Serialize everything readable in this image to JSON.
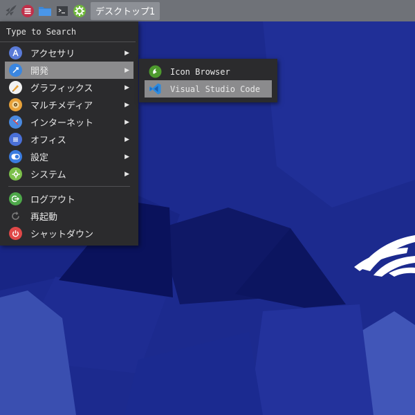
{
  "panel": {
    "workspace_label": "デスクトップ1",
    "icons": [
      "rocket-launcher-icon",
      "menu-icon",
      "folder-icon",
      "terminal-icon",
      "settings-icon"
    ]
  },
  "menu": {
    "search_placeholder": "Type to Search",
    "items": [
      {
        "label": "アクセサリ",
        "icon": "accessories-icon",
        "color": "#5a7bd8",
        "submenu": true
      },
      {
        "label": "開発",
        "icon": "development-icon",
        "color": "#3a86e0",
        "submenu": true,
        "active": true
      },
      {
        "label": "グラフィックス",
        "icon": "graphics-icon",
        "color": "#f2f2f2",
        "submenu": true
      },
      {
        "label": "マルチメディア",
        "icon": "multimedia-icon",
        "color": "#e8a23a",
        "submenu": true
      },
      {
        "label": "インターネット",
        "icon": "internet-icon",
        "color": "#4a8ae0",
        "submenu": true
      },
      {
        "label": "オフィス",
        "icon": "office-icon",
        "color": "#4a70d8",
        "submenu": true
      },
      {
        "label": "設定",
        "icon": "settings-icon",
        "color": "#3a7ce0",
        "submenu": true
      },
      {
        "label": "システム",
        "icon": "system-icon",
        "color": "#7cc04a",
        "submenu": true
      }
    ],
    "actions": [
      {
        "label": "ログアウト",
        "icon": "logout-icon",
        "color": "#4ea84a"
      },
      {
        "label": "再起動",
        "icon": "restart-icon",
        "color": "#7a7a7a"
      },
      {
        "label": "シャットダウン",
        "icon": "power-icon",
        "color": "#e04848"
      }
    ]
  },
  "submenu": {
    "items": [
      {
        "label": "Icon Browser",
        "icon": "icon-browser-icon",
        "color": "#5aa83a"
      },
      {
        "label": "Visual Studio Code",
        "icon": "vscode-icon",
        "color": "#2a8ae0",
        "active": true
      }
    ]
  },
  "colors": {
    "panel": "#6f7278",
    "menu_bg": "#2b2b2d",
    "highlight": "#8b8b8d",
    "desktop": "#1a2a8a"
  }
}
